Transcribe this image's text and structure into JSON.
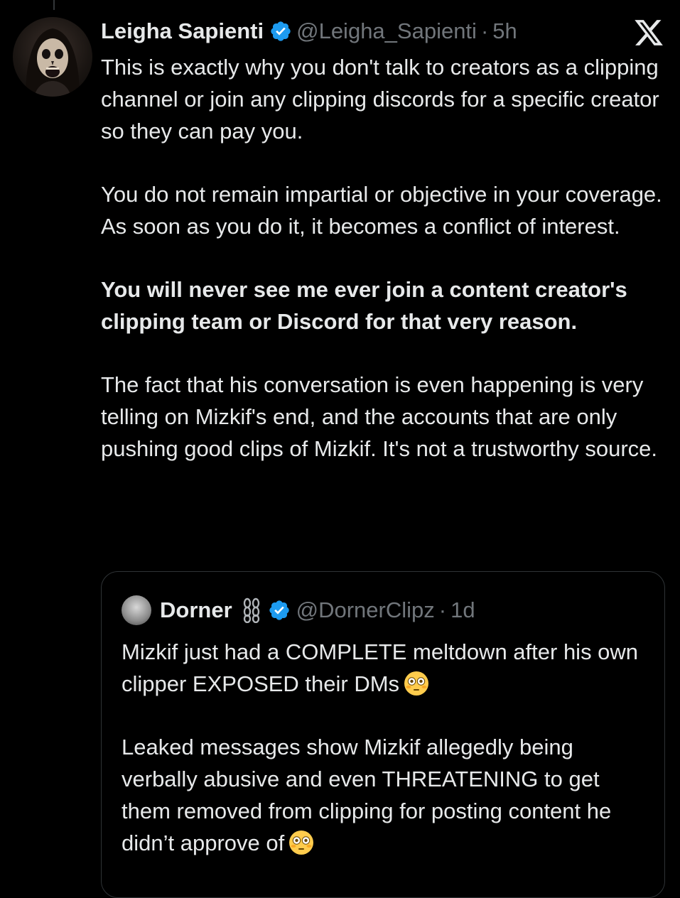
{
  "tweet": {
    "display_name": "Leigha Sapienti",
    "handle": "@Leigha_Sapienti",
    "separator": "·",
    "time": "5h",
    "paragraphs": [
      "This is exactly why you don't talk to creators as a clipping channel or join any clipping discords for a specific creator so they can pay you.",
      "You do not remain impartial or objective in your coverage. As soon as you do it, it becomes a conflict of interest.",
      "You will never see me ever join a content creator's clipping team or Discord for that very reason.",
      "The fact that his conversation is even happening is very telling on Mizkif's end, and the accounts that are only pushing good clips of Mizkif.  It's not a trustworthy source."
    ]
  },
  "quoted_tweet": {
    "display_name": "Dorner",
    "handle": "@DornerClipz",
    "separator": "·",
    "time": "1d",
    "paragraph_1": "Mizkif just had a COMPLETE meltdown after his own clipper EXPOSED their DMs",
    "paragraph_2": "Leaked messages show Mizkif allegedly being verbally abusive and even THREATENING to get them removed from clipping for posting content he didn’t approve of",
    "emoji_name": "flushed-face"
  },
  "icons": {
    "verified": "verified-badge-icon",
    "chain": "chain-link-icon",
    "x_logo": "x-logo-icon"
  },
  "colors": {
    "background": "#000000",
    "text": "#e7e9ea",
    "secondary_text": "#71767b",
    "verified_blue": "#1d9bf0",
    "border": "#2f3336"
  }
}
